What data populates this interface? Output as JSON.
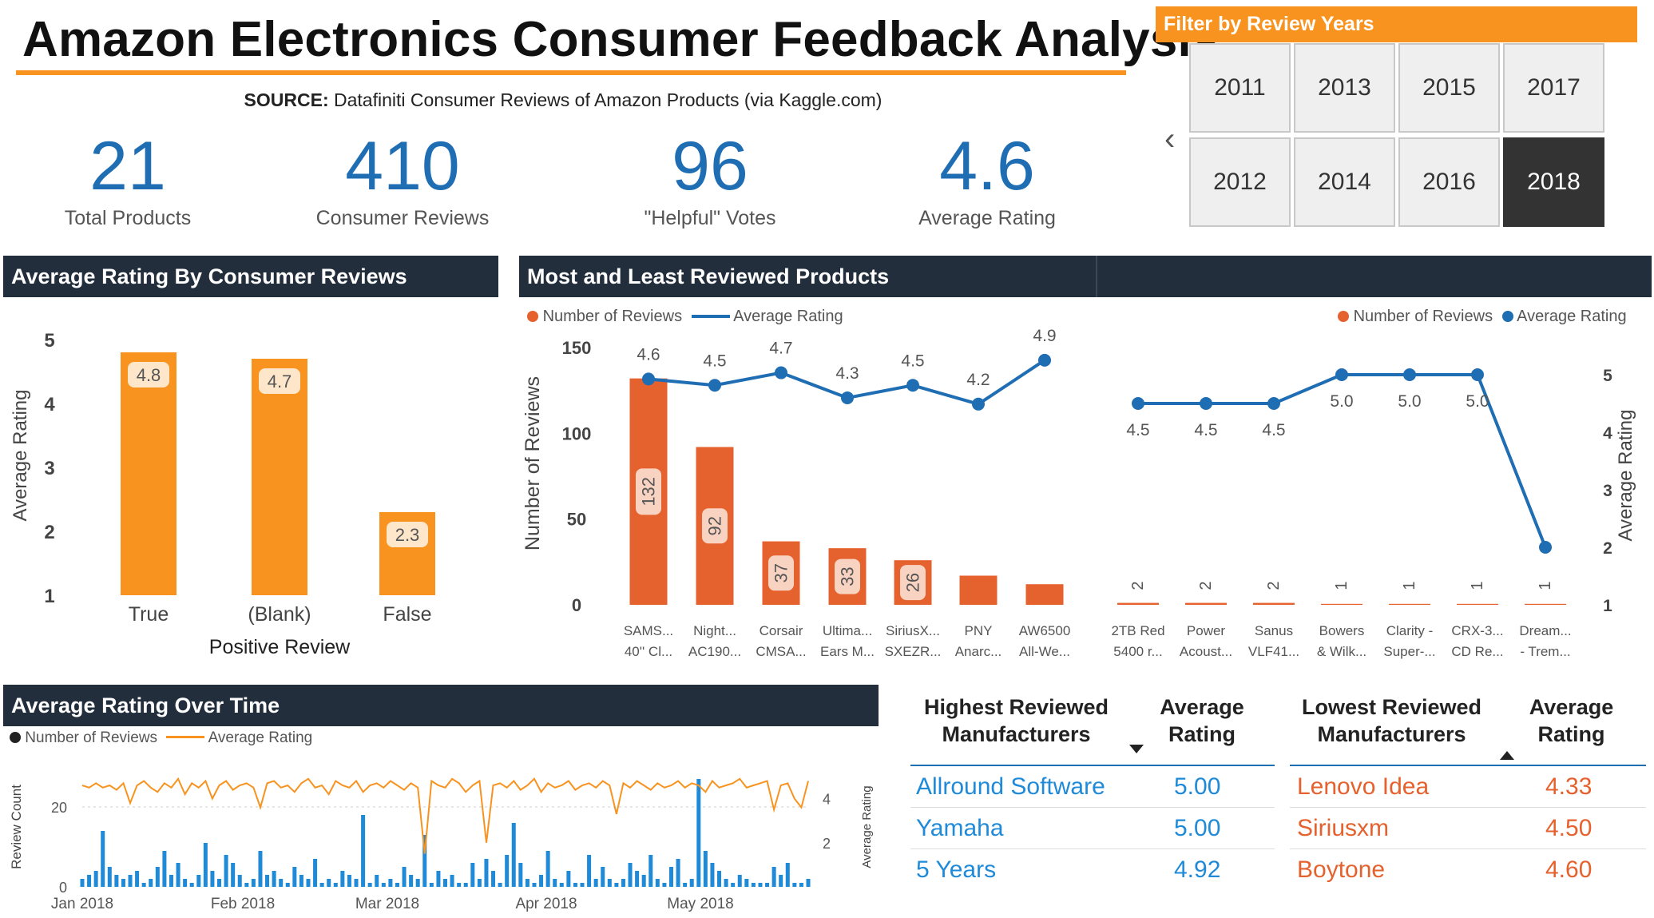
{
  "header": {
    "title": "Amazon Electronics Consumer Feedback Analysis",
    "source_label": "SOURCE:",
    "source_text": "Datafiniti Consumer Reviews of Amazon Products (via Kaggle.com)"
  },
  "kpis": [
    {
      "value": "21",
      "label": "Total Products"
    },
    {
      "value": "410",
      "label": "Consumer Reviews"
    },
    {
      "value": "96",
      "label": "\"Helpful\" Votes"
    },
    {
      "value": "4.6",
      "label": "Average Rating"
    }
  ],
  "filter": {
    "title": "Filter by Review Years",
    "years": [
      "2011",
      "2013",
      "2015",
      "2017",
      "2012",
      "2014",
      "2016",
      "2018"
    ],
    "selected": "2018"
  },
  "colors": {
    "orange": "#f7931e",
    "dark_orange": "#e5612d",
    "blue": "#1f6eb3",
    "navy": "#232e3c"
  },
  "panels": {
    "positive": "Average Rating By Consumer Reviews",
    "most_least": "Most and Least Reviewed Products",
    "over_time": "Average Rating Over Time"
  },
  "legends": {
    "most_reviews": "Number of Reviews",
    "most_rating": "Average Rating",
    "least_reviews": "Number of Reviews",
    "least_rating": "Average Rating",
    "time_reviews": "Number of Reviews",
    "time_rating": "Average Rating"
  },
  "chart_data": [
    {
      "type": "bar",
      "title": "Average Rating By Consumer Reviews",
      "categories": [
        "True",
        "(Blank)",
        "False"
      ],
      "values": [
        4.8,
        4.7,
        2.3
      ],
      "xlabel": "Positive Review",
      "ylabel": "Average Rating",
      "ylim": [
        1,
        5
      ],
      "yticks": [
        1,
        2,
        3,
        4,
        5
      ],
      "color": "#f7931e"
    },
    {
      "type": "bar",
      "title": "Most Reviewed Products",
      "categories": [
        [
          "SAMS...",
          "40'' Cl..."
        ],
        [
          "Night...",
          "AC190..."
        ],
        [
          "Corsair",
          "CMSA..."
        ],
        [
          "Ultima...",
          "Ears M..."
        ],
        [
          "SiriusX...",
          "SXEZR..."
        ],
        [
          "PNY",
          "Anarc..."
        ],
        [
          "AW6500",
          "All-We..."
        ]
      ],
      "series": [
        {
          "name": "Number of Reviews",
          "values": [
            132,
            92,
            37,
            33,
            26,
            17,
            12
          ],
          "labels": [
            "132",
            "92",
            "37",
            "33",
            "26",
            "",
            ""
          ]
        },
        {
          "name": "Average Rating",
          "values": [
            4.6,
            4.5,
            4.7,
            4.3,
            4.5,
            4.2,
            4.9
          ],
          "labels": [
            "4.6",
            "4.5",
            "4.7",
            "4.3",
            "4.5",
            "4.2",
            "4.9"
          ]
        }
      ],
      "ylabel": "Number of Reviews",
      "ylim": [
        0,
        150
      ],
      "yticks": [
        0,
        50,
        100,
        150
      ],
      "y2lim": [
        1,
        5
      ]
    },
    {
      "type": "line",
      "title": "Least Reviewed Products",
      "categories": [
        [
          "2TB Red",
          "5400 r..."
        ],
        [
          "Power",
          "Acoust..."
        ],
        [
          "Sanus",
          "VLF41..."
        ],
        [
          "Bowers",
          "& Wilk..."
        ],
        [
          "Clarity -",
          "Super-..."
        ],
        [
          "CRX-3...",
          "CD Re..."
        ],
        [
          "Dream...",
          "- Trem..."
        ]
      ],
      "series": [
        {
          "name": "Number of Reviews",
          "values": [
            2,
            2,
            2,
            1,
            1,
            1,
            1
          ],
          "labels": [
            "2",
            "2",
            "2",
            "1",
            "1",
            "1",
            "1"
          ]
        },
        {
          "name": "Average Rating",
          "values": [
            4.5,
            4.5,
            4.5,
            5.0,
            5.0,
            5.0,
            2.0
          ],
          "labels": [
            "4.5",
            "4.5",
            "4.5",
            "5.0",
            "5.0",
            "5.0",
            ""
          ]
        }
      ],
      "ylabel": "Average Rating",
      "ylim": [
        1,
        5
      ],
      "yticks": [
        1,
        2,
        3,
        4,
        5
      ]
    },
    {
      "type": "bar",
      "title": "Average Rating Over Time",
      "x_ticks": [
        "Jan 2018",
        "Feb 2018",
        "Mar 2018",
        "Apr 2018",
        "May 2018"
      ],
      "series": [
        {
          "name": "Number of Reviews",
          "values": [
            2,
            3,
            4,
            14,
            5,
            3,
            2,
            3,
            4,
            1,
            2,
            5,
            9,
            3,
            6,
            2,
            1,
            3,
            11,
            4,
            2,
            8,
            6,
            3,
            1,
            2,
            9,
            3,
            4,
            2,
            1,
            5,
            3,
            2,
            7,
            1,
            2,
            1,
            4,
            3,
            2,
            18,
            1,
            3,
            1,
            2,
            1,
            5,
            3,
            2,
            13,
            1,
            4,
            2,
            3,
            1,
            1,
            6,
            2,
            7,
            4,
            1,
            8,
            16,
            6,
            2,
            1,
            3,
            9,
            2,
            1,
            4,
            1,
            1,
            8,
            2,
            5,
            2,
            1,
            2,
            6,
            4,
            3,
            8,
            2,
            1,
            5,
            7,
            1,
            2,
            27,
            9,
            6,
            4,
            2,
            1,
            3,
            2,
            1,
            1,
            1,
            5,
            3,
            6,
            1,
            1,
            2
          ]
        },
        {
          "name": "Average Rating",
          "values": [
            4.6,
            4.5,
            4.7,
            4.5,
            4.6,
            4.4,
            4.7,
            3.8,
            4.6,
            4.8,
            4.5,
            4.3,
            4.7,
            4.5,
            4.9,
            4.2,
            4.7,
            4.5,
            4.8,
            4.0,
            4.6,
            4.8,
            4.4,
            4.6,
            4.7,
            4.5,
            3.6,
            4.7,
            4.8,
            4.5,
            4.6,
            4.3,
            4.7,
            4.9,
            4.5,
            4.6,
            4.2,
            4.8,
            4.6,
            4.5,
            4.8,
            4.3,
            4.6,
            4.7,
            4.5,
            4.8,
            4.6,
            4.4,
            4.7,
            4.5,
            1.5,
            4.8,
            4.6,
            4.5,
            4.9,
            4.7,
            4.3,
            4.6,
            4.8,
            2.0,
            4.6,
            4.7,
            4.5,
            4.8,
            4.4,
            4.6,
            4.9,
            4.3,
            4.7,
            4.5,
            4.6,
            4.8,
            4.4,
            4.6,
            4.7,
            4.5,
            4.8,
            4.6,
            3.3,
            4.7,
            4.5,
            4.8,
            4.6,
            4.4,
            4.7,
            4.5,
            4.6,
            4.8,
            4.5,
            4.7,
            4.6,
            4.3,
            4.8,
            4.5,
            4.6,
            4.7,
            4.9,
            4.5,
            4.6,
            4.7,
            4.8,
            3.5,
            4.6,
            4.7,
            4.0,
            3.6,
            4.8
          ]
        }
      ],
      "ylabel": "Review Count",
      "y2label": "Average Rating",
      "ylim": [
        0,
        30
      ],
      "yticks": [
        0,
        20
      ],
      "y2lim": [
        0,
        5
      ],
      "y2ticks": [
        2,
        4
      ]
    }
  ],
  "tables": {
    "highest": {
      "col1": "Highest Reviewed Manufacturers",
      "col2": "Average Rating",
      "rows": [
        {
          "name": "Allround Software",
          "rating": "5.00"
        },
        {
          "name": "Yamaha",
          "rating": "5.00"
        },
        {
          "name": "5 Years",
          "rating": "4.92"
        }
      ]
    },
    "lowest": {
      "col1": "Lowest Reviewed Manufacturers",
      "col2": "Average Rating",
      "rows": [
        {
          "name": "Lenovo Idea",
          "rating": "4.33"
        },
        {
          "name": "Siriusxm",
          "rating": "4.50"
        },
        {
          "name": "Boytone",
          "rating": "4.60"
        }
      ]
    }
  }
}
